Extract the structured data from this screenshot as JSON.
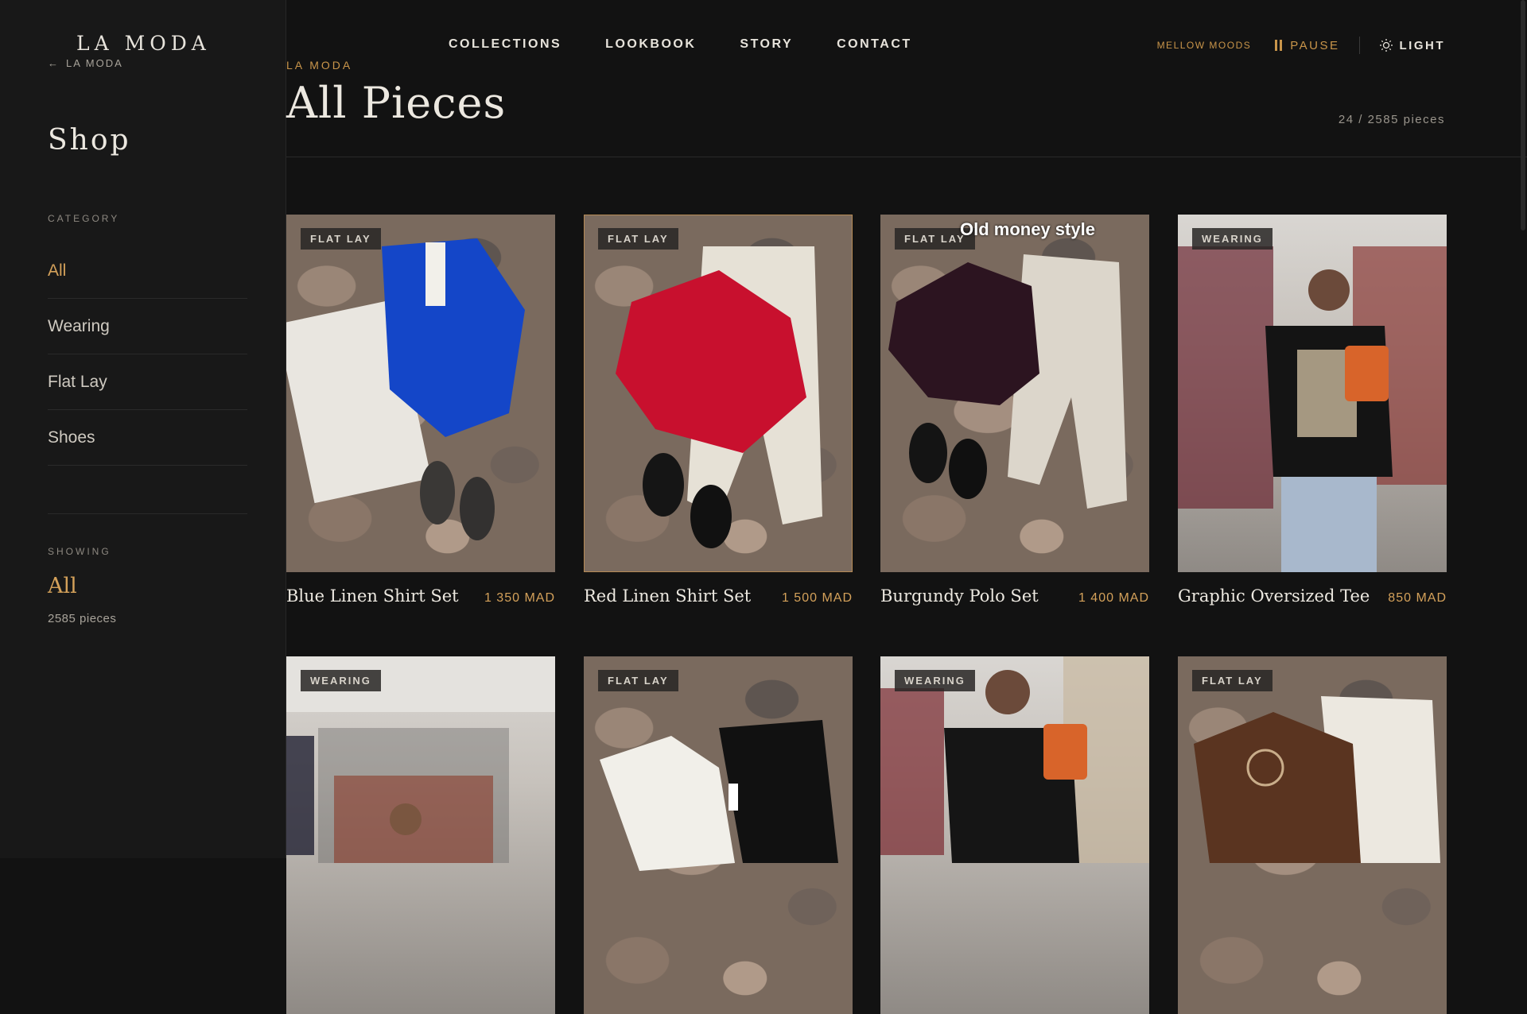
{
  "sidebar": {
    "brand": "LA MODA",
    "back_label": "LA MODA",
    "title": "Shop",
    "category_label": "CATEGORY",
    "categories": [
      {
        "label": "All",
        "active": true
      },
      {
        "label": "Wearing",
        "active": false
      },
      {
        "label": "Flat Lay",
        "active": false
      },
      {
        "label": "Shoes",
        "active": false
      }
    ],
    "showing_label": "SHOWING",
    "showing_value": "All",
    "showing_count": "2585 pieces"
  },
  "nav": {
    "items": [
      "COLLECTIONS",
      "LOOKBOOK",
      "STORY",
      "CONTACT"
    ]
  },
  "controls": {
    "mood": "MELLOW MOODS",
    "pause": "PAUSE",
    "theme": "LIGHT"
  },
  "header": {
    "breadcrumb": "LA MODA",
    "title": "All Pieces",
    "count": "24 / 2585 pieces"
  },
  "products": [
    {
      "badge": "FLAT LAY",
      "name": "Blue Linen Shirt Set",
      "price": "1 350 MAD"
    },
    {
      "badge": "FLAT LAY",
      "name": "Red Linen Shirt Set",
      "price": "1 500 MAD"
    },
    {
      "badge": "FLAT LAY",
      "name": "Burgundy Polo Set",
      "price": "1 400 MAD",
      "overlay_text": "Old money style"
    },
    {
      "badge": "WEARING",
      "name": "Graphic Oversized Tee",
      "price": "850 MAD"
    },
    {
      "badge": "WEARING"
    },
    {
      "badge": "FLAT LAY"
    },
    {
      "badge": "WEARING"
    },
    {
      "badge": "FLAT LAY"
    }
  ],
  "colors": {
    "background": "#121212",
    "sidebar": "#181818",
    "accent": "#d4a15a",
    "text": "#e8e4dc"
  }
}
